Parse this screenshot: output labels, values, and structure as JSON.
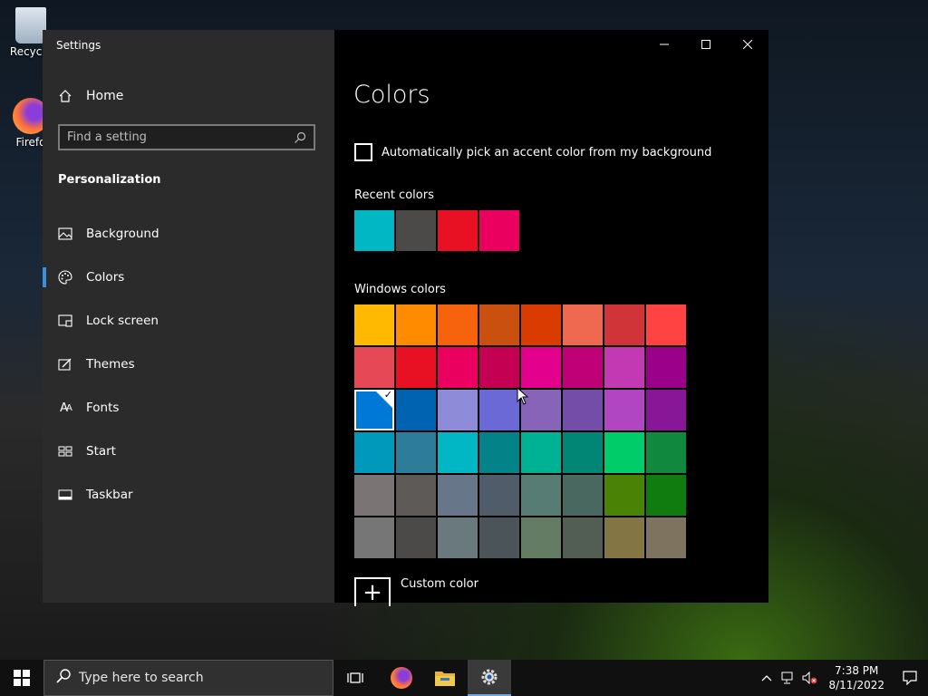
{
  "desktop": {
    "icons": [
      {
        "label": "Recycle"
      },
      {
        "label": "Firefo"
      }
    ]
  },
  "window": {
    "title": "Settings",
    "home_label": "Home",
    "search": {
      "placeholder": "Find a setting",
      "value": ""
    },
    "section": "Personalization",
    "nav": [
      {
        "label": "Background",
        "icon": "picture-icon"
      },
      {
        "label": "Colors",
        "icon": "palette-icon",
        "active": true
      },
      {
        "label": "Lock screen",
        "icon": "lock-screen-icon"
      },
      {
        "label": "Themes",
        "icon": "themes-icon"
      },
      {
        "label": "Fonts",
        "icon": "fonts-icon"
      },
      {
        "label": "Start",
        "icon": "start-icon"
      },
      {
        "label": "Taskbar",
        "icon": "taskbar-icon"
      }
    ]
  },
  "content": {
    "title": "Colors",
    "auto_accent_label": "Automatically pick an accent color from my background",
    "auto_accent_checked": false,
    "recent_label": "Recent colors",
    "recent_colors": [
      "#00B7C3",
      "#4C4A48",
      "#E81123",
      "#EA005E"
    ],
    "windows_label": "Windows colors",
    "windows_colors": [
      "#FFB900",
      "#FF8C00",
      "#F7630C",
      "#CA5010",
      "#DA3B01",
      "#EF6950",
      "#D13438",
      "#FF4343",
      "#E74856",
      "#E81123",
      "#EA005E",
      "#C30052",
      "#E3008C",
      "#BF0077",
      "#C239B3",
      "#9A0089",
      "#0078D7",
      "#0063B1",
      "#8E8CD8",
      "#6B69D6",
      "#8764B8",
      "#744DA9",
      "#B146C2",
      "#881798",
      "#0099BC",
      "#2D7D9A",
      "#00B7C3",
      "#038387",
      "#00B294",
      "#018574",
      "#00CC6A",
      "#10893E",
      "#7A7574",
      "#5D5A58",
      "#68768A",
      "#515C6B",
      "#567C73",
      "#486860",
      "#498205",
      "#107C10",
      "#767676",
      "#4C4A48",
      "#69797E",
      "#4A5459",
      "#647C64",
      "#525E54",
      "#847545",
      "#7E735F"
    ],
    "selected_index": 16,
    "custom_label": "Custom color"
  },
  "taskbar": {
    "search_placeholder": "Type here to search",
    "time": "7:38 PM",
    "date": "8/11/2022"
  }
}
